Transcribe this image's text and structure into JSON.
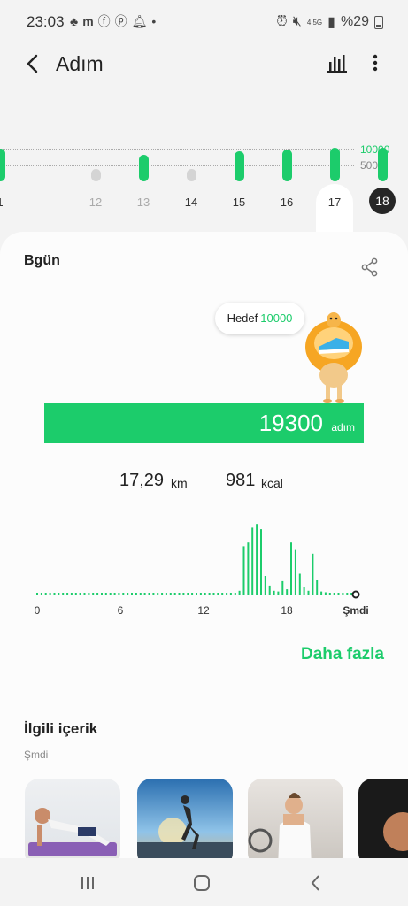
{
  "status_bar": {
    "time": "23:03",
    "left_icons": [
      "tree-icon",
      "m-icon",
      "facebook-icon",
      "pinterest-icon",
      "bell-icon",
      "dot-icon"
    ],
    "network": "4.5G",
    "battery": "%29"
  },
  "header": {
    "title": "Adım"
  },
  "week_chart": {
    "days": [
      {
        "label": "1",
        "steps": 10100,
        "dim": false
      },
      {
        "label": "12",
        "steps": 3000,
        "dim": true
      },
      {
        "label": "13",
        "steps": 8000,
        "dim": true
      },
      {
        "label": "14",
        "steps": 2800,
        "dim": false
      },
      {
        "label": "15",
        "steps": 9200,
        "dim": false
      },
      {
        "label": "16",
        "steps": 9800,
        "dim": false
      },
      {
        "label": "17",
        "steps": 10400,
        "dim": false
      },
      {
        "label": "18",
        "steps": 10400,
        "dim": false,
        "selected": true
      }
    ],
    "goal_label": "10000",
    "half_label": "5000",
    "colors": {
      "active": "#1ccc6b",
      "low": "#d4d4d4"
    }
  },
  "today": {
    "title": "Bgün",
    "goal_prefix": "Hedef",
    "goal_value": "10000",
    "steps": "19300",
    "steps_unit": "adım",
    "distance": "17,29",
    "distance_unit": "km",
    "calories": "981",
    "calories_unit": "kcal"
  },
  "chart_data": {
    "type": "bar",
    "x_ticks": [
      "0",
      "6",
      "12",
      "18",
      "Şmdi"
    ],
    "values": [
      0.02,
      0,
      0,
      0,
      0,
      0,
      0,
      0,
      0,
      0,
      0,
      0,
      0,
      0,
      0,
      0,
      0,
      0,
      0,
      0,
      0,
      0,
      0,
      0,
      0,
      0,
      0.02,
      0,
      0.02,
      0,
      0.02,
      0,
      0.02,
      0,
      0.02,
      0,
      0,
      0,
      0,
      0,
      0,
      0,
      0,
      0,
      0.02,
      0,
      0.02,
      0.05,
      0.65,
      0.7,
      0.9,
      0.95,
      0.88,
      0.25,
      0.12,
      0.05,
      0.04,
      0.18,
      0.07,
      0.7,
      0.6,
      0.28,
      0.1,
      0.05,
      0.55,
      0.2,
      0.04,
      0.03,
      0.02,
      0,
      0.02,
      0.02,
      0.02,
      0,
      0.02
    ],
    "ylim": [
      0,
      1
    ]
  },
  "more_link": "Daha fazla",
  "related": {
    "title": "İlgili içerik",
    "subtitle": "Şmdi"
  }
}
